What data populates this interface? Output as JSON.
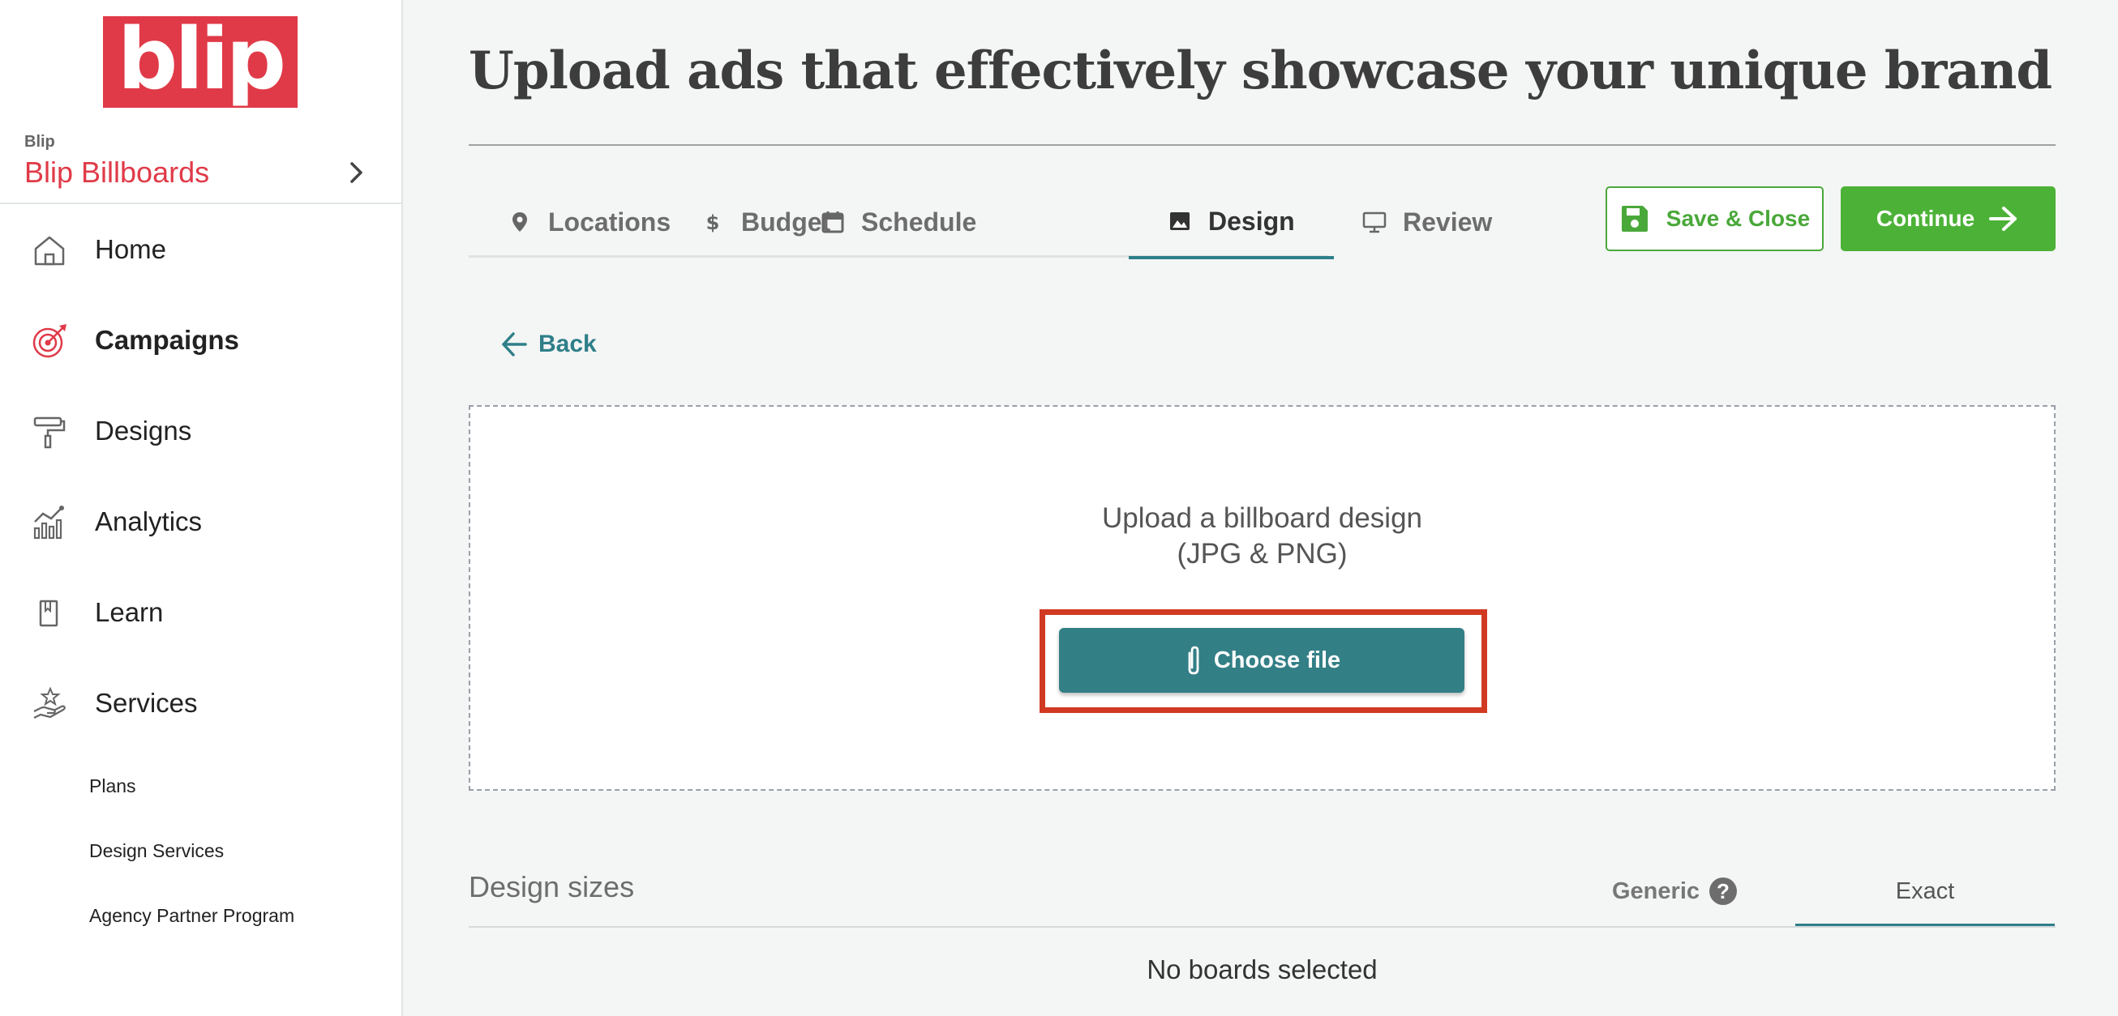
{
  "brand": {
    "logo_text": "blip",
    "account_label": "Blip",
    "account_name": "Blip Billboards"
  },
  "sidebar": {
    "items": [
      {
        "label": "Home",
        "icon": "home-icon"
      },
      {
        "label": "Campaigns",
        "icon": "target-icon",
        "active": true
      },
      {
        "label": "Designs",
        "icon": "paint-roller-icon"
      },
      {
        "label": "Analytics",
        "icon": "analytics-icon"
      },
      {
        "label": "Learn",
        "icon": "book-icon"
      },
      {
        "label": "Services",
        "icon": "hand-star-icon"
      }
    ],
    "sub_items": [
      "Plans",
      "Design Services",
      "Agency Partner Program"
    ]
  },
  "header": {
    "title": "Upload ads that effectively showcase your unique brand"
  },
  "tabs": [
    {
      "label": "Locations",
      "icon": "map-pin-icon"
    },
    {
      "label": "Budget",
      "icon": "dollar-icon"
    },
    {
      "label": "Schedule",
      "icon": "calendar-icon"
    },
    {
      "label": "Design",
      "icon": "image-icon",
      "active": true
    },
    {
      "label": "Review",
      "icon": "monitor-icon"
    }
  ],
  "actions": {
    "save_label": "Save & Close",
    "continue_label": "Continue"
  },
  "back_label": "Back",
  "upload": {
    "line1": "Upload a billboard design",
    "line2": "(JPG & PNG)",
    "button_label": "Choose file"
  },
  "design_sizes": {
    "title": "Design sizes",
    "tab_generic": "Generic",
    "tab_exact": "Exact",
    "empty_message": "No boards selected"
  },
  "colors": {
    "brand_red": "#e03a48",
    "teal": "#337f86",
    "green": "#4cb237",
    "highlight": "#d13a22"
  }
}
